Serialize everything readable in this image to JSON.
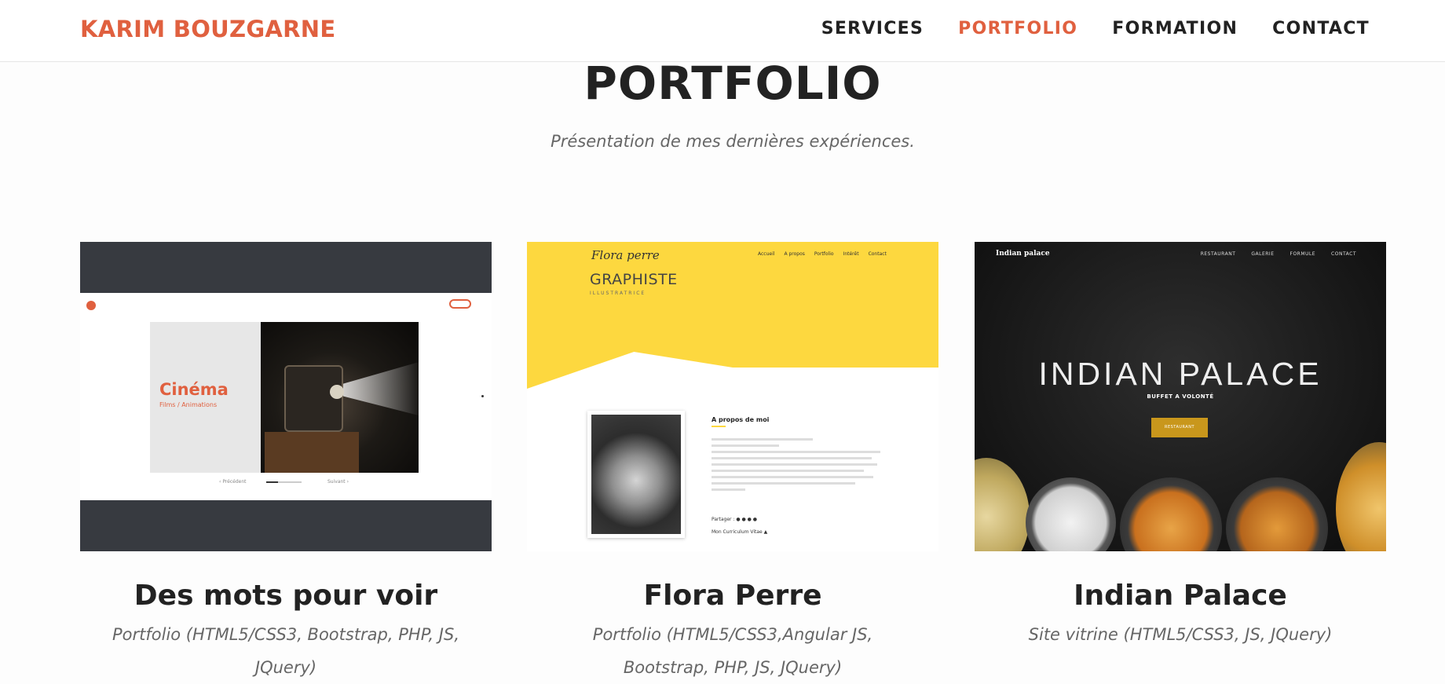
{
  "nav": {
    "brand": "KARIM BOUZGARNE",
    "items": [
      {
        "label": "SERVICES",
        "active": false
      },
      {
        "label": "PORTFOLIO",
        "active": true
      },
      {
        "label": "FORMATION",
        "active": false
      },
      {
        "label": "CONTACT",
        "active": false
      }
    ]
  },
  "section": {
    "title": "PORTFOLIO",
    "subtitle": "Présentation de mes dernières expériences."
  },
  "projects": [
    {
      "title": "Des mots pour voir",
      "desc": "Portfolio (HTML5/CSS3, Bootstrap, PHP, JS, JQuery)",
      "thumb": {
        "heading": "Cinéma",
        "sub": "Films / Animations",
        "prev": "Précédent",
        "next": "Suivant"
      }
    },
    {
      "title": "Flora Perre",
      "desc": "Portfolio (HTML5/CSS3,Angular JS, Bootstrap, PHP, JS, JQuery)",
      "thumb": {
        "signature": "Flora perre",
        "nav": [
          "Accueil",
          "A propos",
          "Portfolio",
          "Intérêt",
          "Contact"
        ],
        "heading": "GRAPHISTE",
        "sub": "ILLUSTRATRICE",
        "about": "A propos de moi",
        "share": "Partager :",
        "cv": "Mon Curriculum Vitae"
      }
    },
    {
      "title": "Indian Palace",
      "desc": "Site vitrine (HTML5/CSS3, JS, JQuery)",
      "thumb": {
        "logo": "Indian palace",
        "nav": [
          "RESTAURANT",
          "GALERIE",
          "FORMULE",
          "CONTACT"
        ],
        "heading": "INDIAN PALACE",
        "sub": "BUFFET A VOLONTÉ",
        "button": "RESTAURANT"
      }
    }
  ],
  "colors": {
    "accent": "#e0603f",
    "yellow": "#fdd83f",
    "gold": "#c9971c"
  }
}
